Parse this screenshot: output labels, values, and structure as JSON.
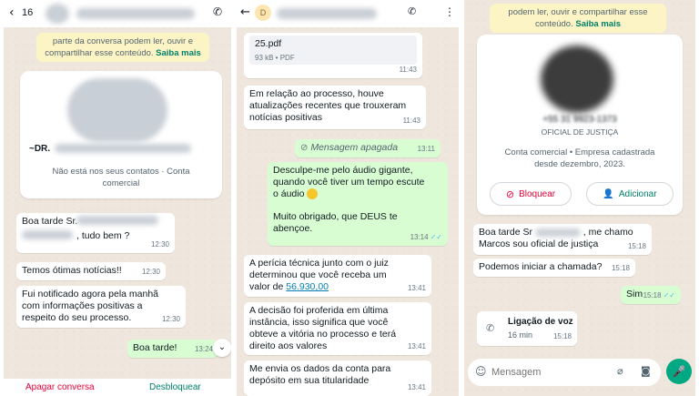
{
  "panel1": {
    "header": {
      "unread_count": "16",
      "back_icon": "chevron-left-icon",
      "call_icon": "phone-icon"
    },
    "banner": {
      "text": "parte da conversa podem ler, ouvir e compartilhar esse conteúdo.",
      "link": "Saiba mais"
    },
    "contact_card": {
      "name_prefix": "~DR.",
      "status": "Não está nos seus contatos · Conta comercial"
    },
    "messages": [
      {
        "line1": "Boa tarde Sr.",
        "line2": ", tudo bem ?",
        "time": "12:30"
      },
      {
        "text": "Temos ótimas notícias!!",
        "time": "12:30"
      },
      {
        "line1": "Fui notificado agora pela manhã",
        "line2": "com informações positivas a",
        "line3": "respeito do seu processo.",
        "time": "12:30"
      },
      {
        "text": "Boa tarde!",
        "time": "13:24"
      }
    ],
    "scroll_down_icon": "chevron-down-icon",
    "bottom": {
      "left_button": "Apagar conversa",
      "right_button": "Desbloquear"
    }
  },
  "panel2": {
    "header": {
      "back_icon": "arrow-left-icon",
      "avatar_letter": "D",
      "add_call_icon": "add-call-icon",
      "menu_icon": "more-vert-icon"
    },
    "file": {
      "name": "25.pdf",
      "meta": "93 kB • PDF",
      "time": "11:43"
    },
    "messages": [
      {
        "line1": "Em relação ao processo, houve",
        "line2": "atualizações recentes que trouxeram",
        "line3": "notícias positivas",
        "time": "11:43"
      },
      {
        "text": "Mensagem apagada",
        "time": "13:11"
      },
      {
        "line1": "Desculpe-me pelo áudio gigante,",
        "line2": "quando você tiver um tempo escute",
        "line3": "o  áudio",
        "line4": "Muito obrigado, que DEUS te",
        "line5": "abençoe.",
        "time": "13:14"
      },
      {
        "line1": "A perícia técnica junto com o  juiz",
        "line2": "determinou que você receba um",
        "line3": "valor de",
        "amount": "56.930,00",
        "time": "13:41"
      },
      {
        "line1": "A decisão foi proferida em última",
        "line2": "instância, isso significa que você",
        "line3": "obteve a vitória no processo e terá",
        "line4": "direito aos valores",
        "time": "13:41"
      },
      {
        "line1": "Me envia os dados da conta para",
        "line2": "depósito em sua titularidade",
        "time": "13:41"
      }
    ]
  },
  "panel3": {
    "banner": {
      "text": "podem ler, ouvir e compartilhar esse conteúdo.",
      "link": "Saiba mais"
    },
    "profile": {
      "phone": "+55 31 9923-1373",
      "role": "OFICIAL DE JUSTIÇA",
      "line1": "Conta comercial • Empresa cadastrada",
      "line2": "desde dezembro, 2023.",
      "block_label": "Bloquear",
      "add_label": "Adicionar"
    },
    "messages": [
      {
        "line1a": "Boa tarde Sr",
        "line1b": ", me chamo",
        "line2": "Marcos sou oficial de justiça",
        "time": "15:18"
      },
      {
        "text": "Podemos iniciar a chamada?",
        "time": "15:18"
      },
      {
        "text": "Sim",
        "time": "15:18"
      }
    ],
    "call": {
      "title": "Ligação de voz",
      "duration": "16 min",
      "time": "15:18"
    },
    "input": {
      "placeholder": "Mensagem"
    }
  }
}
